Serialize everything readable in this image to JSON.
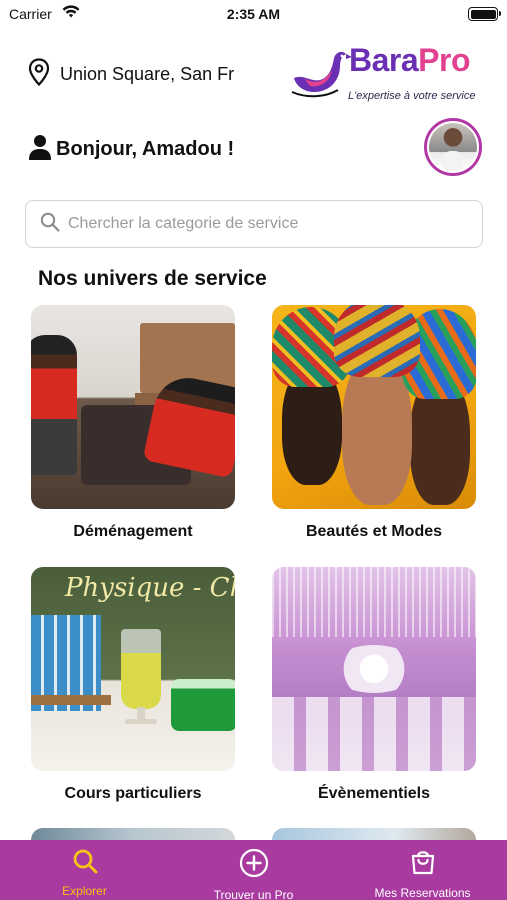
{
  "status_bar": {
    "carrier": "Carrier",
    "time": "2:35 AM",
    "battery_level": 1.0
  },
  "location": {
    "text": "Union Square, San Fr",
    "icon": "location-pin-icon"
  },
  "logo": {
    "brand_part1": "Bara",
    "brand_part2": "Pro",
    "tagline": "L'expertise à votre service",
    "color_primary": "#6b2fb3",
    "color_secondary": "#e2418f"
  },
  "greeting": {
    "text": "Bonjour, Amadou !",
    "icon": "user-icon"
  },
  "search": {
    "placeholder": "Chercher la categorie de service",
    "value": "",
    "icon": "search-icon"
  },
  "section": {
    "title": "Nos univers de service"
  },
  "categories": [
    {
      "label": "Déménagement"
    },
    {
      "label": "Beautés et Modes"
    },
    {
      "label": "Cours particuliers"
    },
    {
      "label": "Évènementiels"
    }
  ],
  "tabbar": {
    "background": "#a93ba0",
    "active_color": "#f6c216",
    "tabs": [
      {
        "label": "Explorer",
        "icon": "search-icon",
        "active": true
      },
      {
        "label": "Trouver un Pro",
        "icon": "plus-circle-icon",
        "active": false
      },
      {
        "label": "Mes Reservations",
        "icon": "shopping-bag-icon",
        "active": false
      }
    ]
  }
}
